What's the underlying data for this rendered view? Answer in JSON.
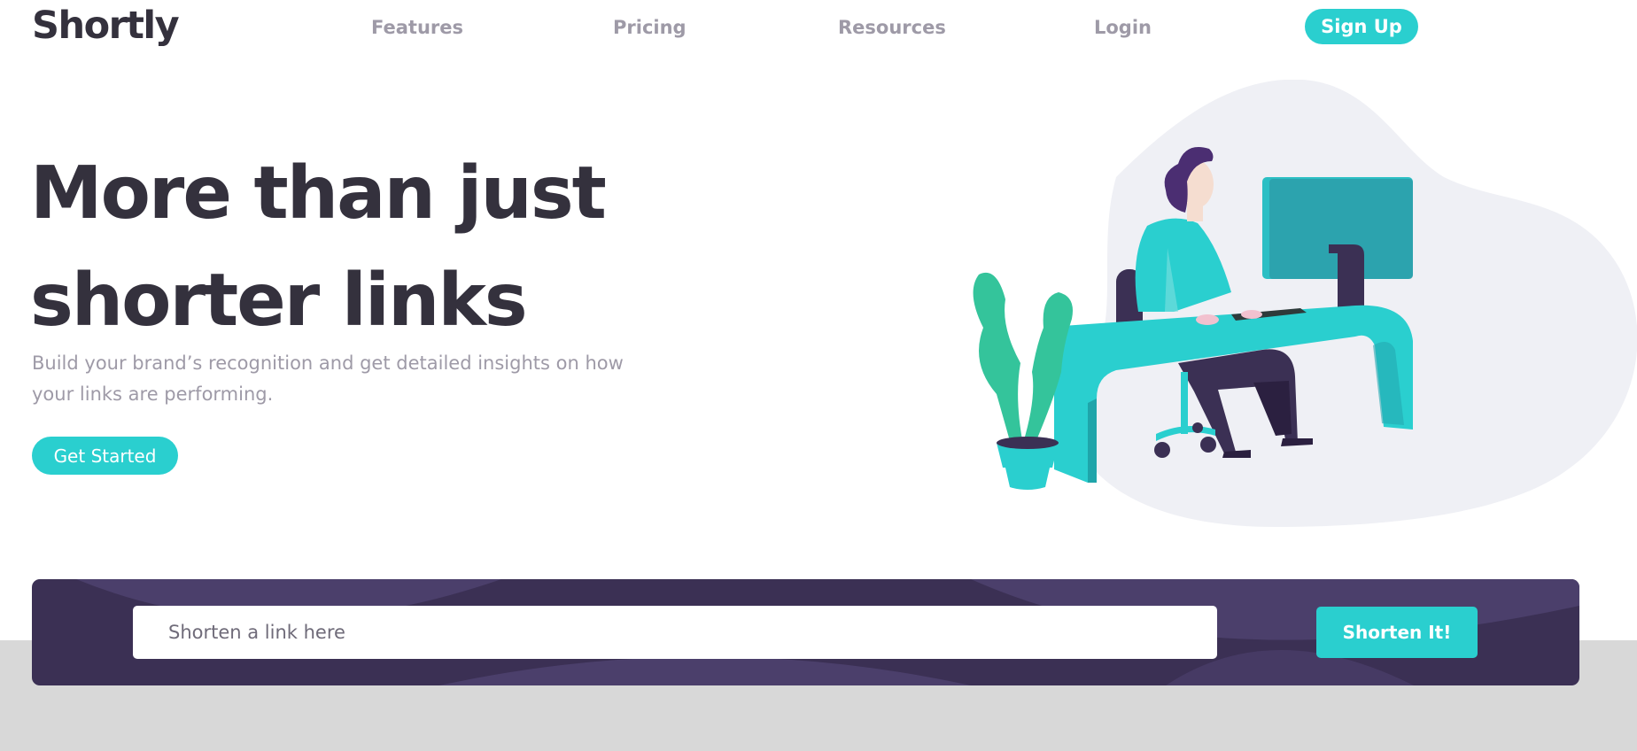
{
  "header": {
    "logo": "Shortly",
    "nav": [
      {
        "label": "Features"
      },
      {
        "label": "Pricing"
      },
      {
        "label": "Resources"
      },
      {
        "label": "Login"
      }
    ],
    "signup_label": "Sign Up"
  },
  "hero": {
    "title": "More than just shorter links",
    "subtitle": "Build your brand’s recognition and get detailed insights on how your links are performing.",
    "cta_label": "Get Started",
    "illustration": "person-working-at-desk-illustration"
  },
  "shorten": {
    "placeholder": "Shorten a link here",
    "button_label": "Shorten It!"
  },
  "colors": {
    "primary_cyan": "#2acfcf",
    "dark_violet": "#3b3054",
    "very_dark_blue": "#34313d",
    "grayish_violet": "#9e9aa7",
    "band_gray": "#d8d8d8"
  }
}
